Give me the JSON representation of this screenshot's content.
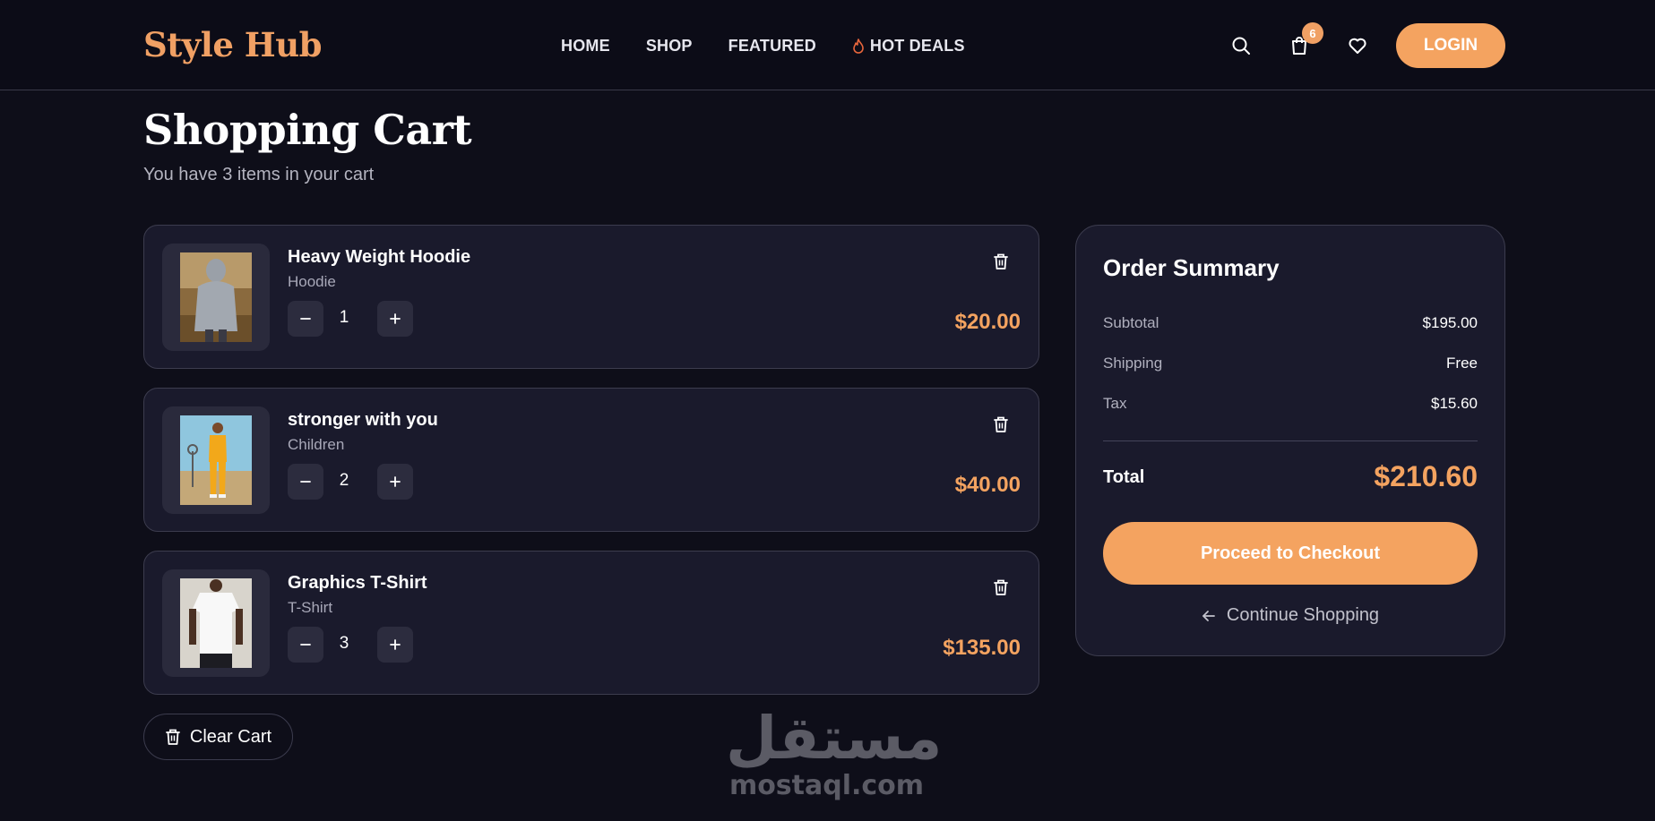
{
  "header": {
    "logo": "Style Hub",
    "nav": [
      {
        "label": "HOME"
      },
      {
        "label": "SHOP"
      },
      {
        "label": "FEATURED"
      },
      {
        "label": "HOT DEALS",
        "icon": "flame-icon"
      }
    ],
    "cart_count": "6",
    "login_label": "LOGIN",
    "icons": [
      "search-icon",
      "cart-icon",
      "heart-icon"
    ]
  },
  "page": {
    "title": "Shopping Cart",
    "subtitle": "You have 3 items in your cart"
  },
  "items": [
    {
      "name": "Heavy Weight Hoodie",
      "category": "Hoodie",
      "quantity": "1",
      "price": "$20.00"
    },
    {
      "name": "stronger with you",
      "category": "Children",
      "quantity": "2",
      "price": "$40.00"
    },
    {
      "name": "Graphics T-Shirt",
      "category": "T-Shirt",
      "quantity": "3",
      "price": "$135.00"
    }
  ],
  "clear_cart_label": "Clear Cart",
  "summary": {
    "title": "Order Summary",
    "rows": [
      {
        "label": "Subtotal",
        "value": "$195.00"
      },
      {
        "label": "Shipping",
        "value": "Free"
      },
      {
        "label": "Tax",
        "value": "$15.60"
      }
    ],
    "total_label": "Total",
    "total_value": "$210.60",
    "checkout_label": "Proceed to Checkout",
    "continue_label": "Continue Shopping"
  },
  "watermark": {
    "arabic": "مستقل",
    "latin": "mostaql.com"
  },
  "colors": {
    "accent": "#f4a360",
    "background": "#0e0e19",
    "card": "#1a1a2c"
  }
}
